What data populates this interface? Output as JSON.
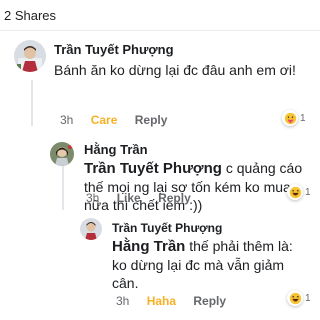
{
  "shares": "2 Shares",
  "colors": {
    "care": "#f7b125",
    "haha": "#f7b125",
    "meta": "#65676b"
  },
  "comments": [
    {
      "author": "Trần Tuyết Phượng",
      "text": "Bánh ăn ko dừng lại đc đâu anh em ơi!",
      "time": "3h",
      "reaction_label": "Care",
      "reply_label": "Reply",
      "reaction_icon": "care-emoji-icon",
      "reaction_count": "1"
    },
    {
      "author": "Hằng Trần",
      "mention": "Trần Tuyết Phượng",
      "text_line1": "c quảng cáo",
      "text_line2": "thế mọi ng lại sợ tốn kém ko mua",
      "text_line3": "nữa thì chết iem :))",
      "time": "3h",
      "like_label": "Like",
      "reply_label": "Reply",
      "reaction_icon": "haha-emoji-icon",
      "reaction_count": "1"
    },
    {
      "author": "Trần Tuyết Phượng",
      "mention": "Hằng Trần",
      "text_line1": "thế phải thêm là:",
      "text_line2": "ko dừng lại đc mà vẫn giảm",
      "text_line3": "cân.",
      "time": "3h",
      "reaction_label": "Haha",
      "reply_label": "Reply",
      "reaction_icon": "haha-emoji-icon",
      "reaction_count": "1"
    }
  ]
}
